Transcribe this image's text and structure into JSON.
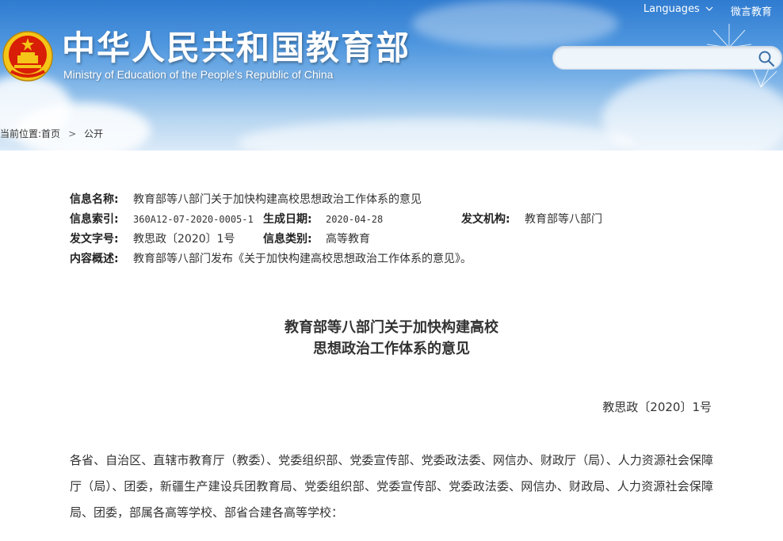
{
  "header": {
    "site_title": "中华人民共和国教育部",
    "site_subtitle": "Ministry of Education of the People's Republic of China",
    "languages_label": "Languages",
    "weibo_label": "微言教育",
    "search_placeholder": ""
  },
  "breadcrumb": {
    "prefix": "当前位置:",
    "home": "首页",
    "current": "公开"
  },
  "meta": {
    "name_label": "信息名称:",
    "name_value": "教育部等八部门关于加快构建高校思想政治工作体系的意见",
    "index_label": "信息索引:",
    "index_value": "360A12-07-2020-0005-1",
    "date_label": "生成日期:",
    "date_value": "2020-04-28",
    "issuer_label": "发文机构:",
    "issuer_value": "教育部等八部门",
    "docno_label": "发文字号:",
    "docno_value": "教思政〔2020〕1号",
    "category_label": "信息类别:",
    "category_value": "高等教育",
    "summary_label": "内容概述:",
    "summary_value": "教育部等八部门发布《关于加快构建高校思想政治工作体系的意见》。"
  },
  "document": {
    "title_line1": "教育部等八部门关于加快构建高校",
    "title_line2": "思想政治工作体系的意见",
    "number": "教思政〔2020〕1号",
    "body": "各省、自治区、直辖市教育厅（教委）、党委组织部、党委宣传部、党委政法委、网信办、财政厅（局）、人力资源社会保障厅（局）、团委，新疆生产建设兵团教育局、党委组织部、党委宣传部、党委政法委、网信办、财政局、人力资源社会保障局、团委，部属各高等学校、部省合建各高等学校："
  },
  "colors": {
    "header_blue": "#2f7bd0",
    "emblem_red": "#d81e06",
    "emblem_gold": "#f5c518"
  },
  "icons": [
    "national-emblem-icon",
    "chevron-down-icon",
    "search-icon",
    "chevron-right-icon"
  ]
}
